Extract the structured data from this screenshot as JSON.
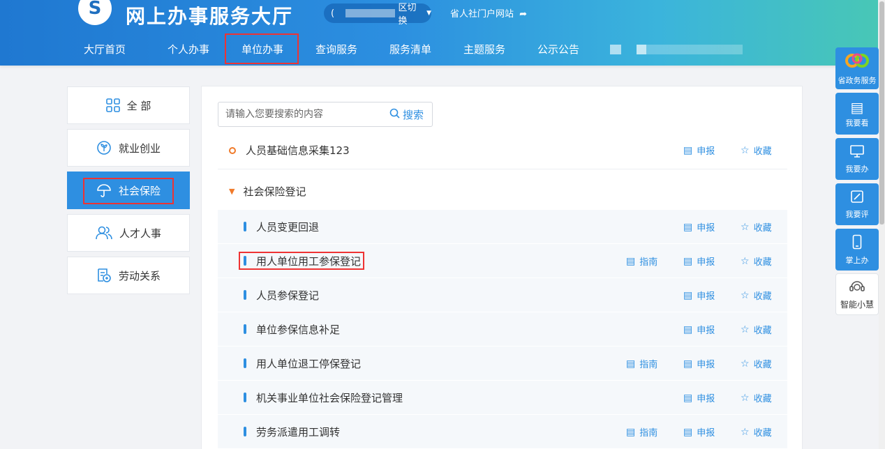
{
  "header": {
    "site_title": "网上办事服务大厅",
    "logo_glyph": "S",
    "region_switch_label": "区切换",
    "portal_link": "省人社门户网站",
    "nav": [
      {
        "label": "大厅首页"
      },
      {
        "label": "个人办事"
      },
      {
        "label": "单位办事"
      },
      {
        "label": "查询服务"
      },
      {
        "label": "服务清单"
      },
      {
        "label": "主题服务"
      },
      {
        "label": "公示公告"
      }
    ],
    "active_nav": "单位办事"
  },
  "sidebar": {
    "items": [
      {
        "label": "全 部",
        "icon": "grid-icon"
      },
      {
        "label": "就业创业",
        "icon": "sprout-icon"
      },
      {
        "label": "社会保险",
        "icon": "umbrella-icon"
      },
      {
        "label": "人才人事",
        "icon": "people-icon"
      },
      {
        "label": "劳动关系",
        "icon": "document-icon"
      }
    ],
    "active": "社会保险"
  },
  "search": {
    "placeholder": "请输入您要搜索的内容",
    "button_label": "搜索"
  },
  "actions": {
    "apply": "申报",
    "favorite": "收藏",
    "guide": "指南"
  },
  "services": {
    "top_item": "人员基础信息采集123",
    "group": "社会保险登记",
    "sub_items": [
      {
        "label": "人员变更回退",
        "guide": false
      },
      {
        "label": "用人单位用工参保登记",
        "guide": true
      },
      {
        "label": "人员参保登记",
        "guide": false
      },
      {
        "label": "单位参保信息补足",
        "guide": false
      },
      {
        "label": "用人单位退工停保登记",
        "guide": true
      },
      {
        "label": "机关事业单位社会保险登记管理",
        "guide": false
      },
      {
        "label": "劳务派遣用工调转",
        "guide": true
      }
    ]
  },
  "float_toolbar": [
    {
      "label": "省政务服务",
      "icon": "gov-logo-icon"
    },
    {
      "label": "我要看",
      "icon": "book-icon"
    },
    {
      "label": "我要办",
      "icon": "monitor-icon"
    },
    {
      "label": "我要评",
      "icon": "edit-icon"
    },
    {
      "label": "掌上办",
      "icon": "phone-icon"
    },
    {
      "label": "智能小慧",
      "icon": "headset-icon"
    }
  ],
  "colors": {
    "primary": "#2e8fe1",
    "accent_orange": "#f07a2a",
    "highlight_red": "#ee3333"
  }
}
